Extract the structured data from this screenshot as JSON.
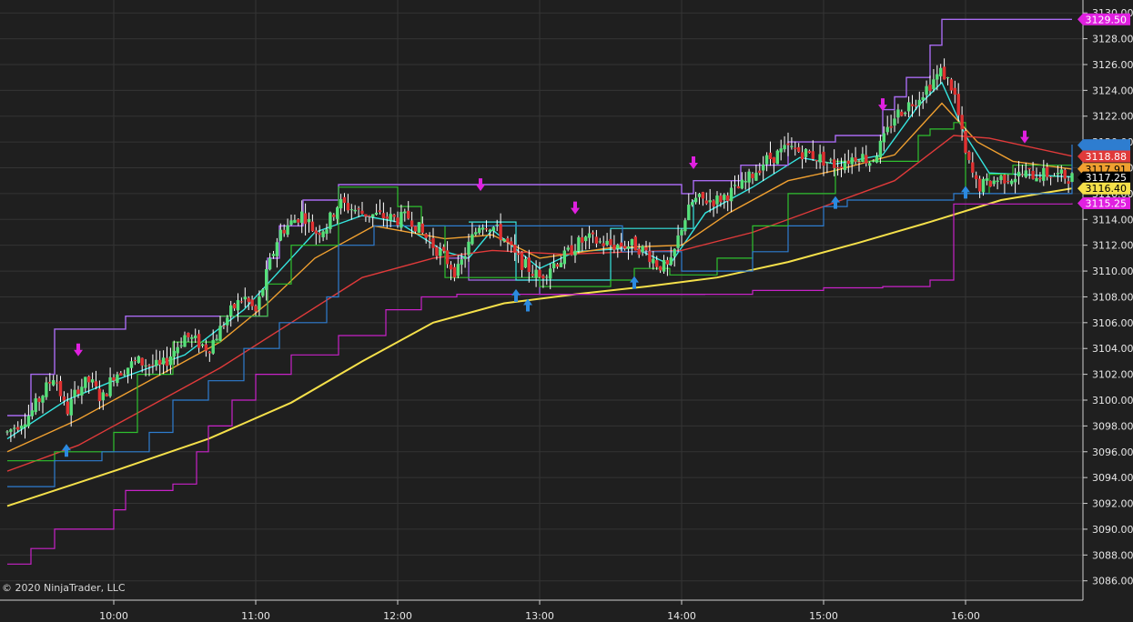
{
  "copyright": "© 2020 NinjaTrader, LLC",
  "colors": {
    "background": "#1f1f1f",
    "grid": "#343434",
    "axis": "#cfcfcf",
    "up_candle": "#56e07a",
    "down_candle": "#e03131",
    "wick": "#ffffff",
    "ema_fast": "#35e6e0",
    "ema_mid": "#f0a030",
    "ema_slow": "#e03a3a",
    "sma_long": "#f5e04a",
    "donchian_fast_high": "#a86af0",
    "donchian_fast_low": "#a86af0",
    "donchian_mid": "#2fc02f",
    "donchian_slow": "#2e7dd0",
    "donchian_slowest": "#c822c8",
    "arrow_up": "#2b8ae0",
    "arrow_down": "#e020e0"
  },
  "chart_data": {
    "type": "candlestick",
    "xlabel": "",
    "ylabel": "",
    "x_range": [
      "09:15",
      "16:45"
    ],
    "ylim": [
      3084.5,
      3131.0
    ],
    "x_ticks": [
      "10:00",
      "11:00",
      "12:00",
      "13:00",
      "14:00",
      "15:00",
      "16:00"
    ],
    "y_ticks": [
      "3086.00",
      "3088.00",
      "3090.00",
      "3092.00",
      "3094.00",
      "3096.00",
      "3098.00",
      "3100.00",
      "3102.00",
      "3104.00",
      "3106.00",
      "3108.00",
      "3110.00",
      "3112.00",
      "3114.00",
      "3116.00",
      "3118.00",
      "3120.00",
      "3122.00",
      "3124.00",
      "3126.00",
      "3128.00",
      "3130.00"
    ],
    "grid": true,
    "price_labels": [
      {
        "value": 3129.5,
        "text": "3129.50",
        "color": "#e020e0",
        "text_color": "#ffffff"
      },
      {
        "value": 3119.75,
        "text": "",
        "color": "#2e7dd0",
        "text_color": "#ffffff"
      },
      {
        "value": 3118.88,
        "text": "3118.88",
        "color": "#e03a3a",
        "text_color": "#ffffff"
      },
      {
        "value": 3117.91,
        "text": "3117.91",
        "color": "#f0a030",
        "text_color": "#000000"
      },
      {
        "value": 3117.25,
        "text": "3117.25",
        "color": "#000000",
        "text_color": "#ffffff"
      },
      {
        "value": 3116.4,
        "text": "3116.40",
        "color": "#f5e04a",
        "text_color": "#000000"
      },
      {
        "value": 3115.25,
        "text": "3115.25",
        "color": "#e020e0",
        "text_color": "#ffffff"
      }
    ],
    "price_path": [
      [
        "09:15",
        3097.5
      ],
      [
        "09:25",
        3099.0
      ],
      [
        "09:35",
        3102.0
      ],
      [
        "09:40",
        3099.0
      ],
      [
        "09:45",
        3101.0
      ],
      [
        "09:50",
        3101.5
      ],
      [
        "09:55",
        3100.0
      ],
      [
        "10:00",
        3102.0
      ],
      [
        "10:10",
        3103.0
      ],
      [
        "10:20",
        3102.5
      ],
      [
        "10:30",
        3105.0
      ],
      [
        "10:40",
        3104.0
      ],
      [
        "10:50",
        3107.0
      ],
      [
        "10:55",
        3108.0
      ],
      [
        "11:00",
        3106.8
      ],
      [
        "11:05",
        3110.0
      ],
      [
        "11:10",
        3113.0
      ],
      [
        "11:20",
        3114.5
      ],
      [
        "11:25",
        3113.0
      ],
      [
        "11:30",
        3113.5
      ],
      [
        "11:35",
        3115.3
      ],
      [
        "11:45",
        3114.5
      ],
      [
        "12:00",
        3114.0
      ],
      [
        "12:05",
        3114.2
      ],
      [
        "12:10",
        3113.0
      ],
      [
        "12:20",
        3111.0
      ],
      [
        "12:25",
        3109.8
      ],
      [
        "12:30",
        3112.0
      ],
      [
        "12:35",
        3113.8
      ],
      [
        "12:40",
        3113.5
      ],
      [
        "12:45",
        3112.5
      ],
      [
        "12:50",
        3111.0
      ],
      [
        "13:00",
        3109.5
      ],
      [
        "13:05",
        3110.5
      ],
      [
        "13:10",
        3111.0
      ],
      [
        "13:15",
        3112.0
      ],
      [
        "13:20",
        3112.5
      ],
      [
        "13:30",
        3112.0
      ],
      [
        "13:40",
        3112.0
      ],
      [
        "13:45",
        3111.5
      ],
      [
        "13:50",
        3110.5
      ],
      [
        "13:55",
        3110.2
      ],
      [
        "14:00",
        3113.5
      ],
      [
        "14:05",
        3115.5
      ],
      [
        "14:15",
        3115.5
      ],
      [
        "14:25",
        3116.5
      ],
      [
        "14:35",
        3118.5
      ],
      [
        "14:45",
        3119.5
      ],
      [
        "14:55",
        3119.0
      ],
      [
        "15:05",
        3118.2
      ],
      [
        "15:15",
        3119.0
      ],
      [
        "15:20",
        3118.5
      ],
      [
        "15:25",
        3120.0
      ],
      [
        "15:30",
        3122.0
      ],
      [
        "15:40",
        3123.5
      ],
      [
        "15:45",
        3124.5
      ],
      [
        "15:50",
        3125.5
      ],
      [
        "15:55",
        3124.0
      ],
      [
        "16:00",
        3119.0
      ],
      [
        "16:05",
        3116.5
      ],
      [
        "16:15",
        3117.2
      ],
      [
        "16:25",
        3117.5
      ],
      [
        "16:35",
        3117.5
      ],
      [
        "16:45",
        3117.25
      ]
    ],
    "series": [
      {
        "name": "",
        "color": "#35e6e0",
        "width": 1.4,
        "step": false,
        "points": [
          [
            "09:15",
            3097.0
          ],
          [
            "09:40",
            3100.0
          ],
          [
            "10:00",
            3101.5
          ],
          [
            "10:30",
            3103.5
          ],
          [
            "10:55",
            3107.0
          ],
          [
            "11:05",
            3109.0
          ],
          [
            "11:25",
            3113.0
          ],
          [
            "11:45",
            3114.3
          ],
          [
            "12:00",
            3113.8
          ],
          [
            "12:20",
            3111.5
          ],
          [
            "12:30",
            3111.0
          ],
          [
            "12:40",
            3113.2
          ],
          [
            "13:00",
            3110.2
          ],
          [
            "13:15",
            3111.5
          ],
          [
            "13:40",
            3111.8
          ],
          [
            "13:55",
            3110.5
          ],
          [
            "14:10",
            3114.5
          ],
          [
            "14:30",
            3116.5
          ],
          [
            "14:50",
            3118.8
          ],
          [
            "15:05",
            3118.3
          ],
          [
            "15:25",
            3119.0
          ],
          [
            "15:40",
            3122.8
          ],
          [
            "15:50",
            3124.6
          ],
          [
            "16:00",
            3120.5
          ],
          [
            "16:10",
            3117.6
          ],
          [
            "16:45",
            3117.3
          ]
        ]
      },
      {
        "name": "",
        "color": "#f0a030",
        "width": 1.4,
        "step": false,
        "points": [
          [
            "09:15",
            3096.0
          ],
          [
            "09:45",
            3098.5
          ],
          [
            "10:15",
            3101.5
          ],
          [
            "10:45",
            3104.5
          ],
          [
            "11:05",
            3107.5
          ],
          [
            "11:25",
            3111.0
          ],
          [
            "11:50",
            3113.5
          ],
          [
            "12:20",
            3112.5
          ],
          [
            "12:40",
            3112.8
          ],
          [
            "13:00",
            3111.0
          ],
          [
            "13:30",
            3111.8
          ],
          [
            "14:00",
            3112.0
          ],
          [
            "14:20",
            3114.5
          ],
          [
            "14:45",
            3117.0
          ],
          [
            "15:05",
            3117.8
          ],
          [
            "15:30",
            3119.0
          ],
          [
            "15:50",
            3123.0
          ],
          [
            "16:05",
            3120.0
          ],
          [
            "16:20",
            3118.5
          ],
          [
            "16:45",
            3117.9
          ]
        ]
      },
      {
        "name": "",
        "color": "#e03a3a",
        "width": 1.4,
        "step": false,
        "points": [
          [
            "09:15",
            3094.5
          ],
          [
            "09:45",
            3096.5
          ],
          [
            "10:15",
            3099.5
          ],
          [
            "10:45",
            3102.5
          ],
          [
            "11:15",
            3106.0
          ],
          [
            "11:45",
            3109.5
          ],
          [
            "12:15",
            3111.0
          ],
          [
            "12:40",
            3111.6
          ],
          [
            "13:10",
            3111.3
          ],
          [
            "13:40",
            3111.5
          ],
          [
            "14:00",
            3111.6
          ],
          [
            "14:30",
            3113.0
          ],
          [
            "15:00",
            3115.0
          ],
          [
            "15:30",
            3117.0
          ],
          [
            "15:55",
            3120.5
          ],
          [
            "16:10",
            3120.3
          ],
          [
            "16:45",
            3118.9
          ]
        ]
      },
      {
        "name": "",
        "color": "#f5e04a",
        "width": 2,
        "step": false,
        "points": [
          [
            "09:15",
            3091.8
          ],
          [
            "10:00",
            3094.5
          ],
          [
            "10:40",
            3097.0
          ],
          [
            "11:15",
            3099.8
          ],
          [
            "11:45",
            3103.0
          ],
          [
            "12:15",
            3106.0
          ],
          [
            "12:45",
            3107.5
          ],
          [
            "13:15",
            3108.2
          ],
          [
            "13:45",
            3108.8
          ],
          [
            "14:15",
            3109.5
          ],
          [
            "14:45",
            3110.7
          ],
          [
            "15:15",
            3112.2
          ],
          [
            "15:45",
            3113.8
          ],
          [
            "16:15",
            3115.5
          ],
          [
            "16:45",
            3116.4
          ]
        ]
      },
      {
        "name": "",
        "color": "#a86af0",
        "width": 1.4,
        "step": true,
        "points": [
          [
            "09:15",
            3098.8
          ],
          [
            "09:25",
            3102.0
          ],
          [
            "09:35",
            3105.5
          ],
          [
            "10:05",
            3106.5
          ],
          [
            "10:35",
            3106.5
          ],
          [
            "11:05",
            3111.0
          ],
          [
            "11:10",
            3113.5
          ],
          [
            "11:20",
            3115.5
          ],
          [
            "11:35",
            3116.7
          ],
          [
            "13:45",
            3116.7
          ],
          [
            "14:00",
            3116.0
          ],
          [
            "14:05",
            3117.0
          ],
          [
            "14:25",
            3118.2
          ],
          [
            "14:45",
            3120.0
          ],
          [
            "15:05",
            3120.5
          ],
          [
            "15:25",
            3122.5
          ],
          [
            "15:30",
            3123.5
          ],
          [
            "15:35",
            3125.0
          ],
          [
            "15:45",
            3127.5
          ],
          [
            "15:50",
            3129.5
          ],
          [
            "16:45",
            3129.5
          ]
        ]
      },
      {
        "name": "",
        "color": "#a86af0",
        "width": 1.2,
        "step": true,
        "points": [
          [
            "12:20",
            3111.0
          ],
          [
            "12:30",
            3109.3
          ],
          [
            "12:50",
            3109.3
          ],
          [
            "13:00",
            3108.2
          ],
          [
            "14:10",
            3108.2
          ]
        ]
      },
      {
        "name": "",
        "color": "#35e6e0",
        "width": 1.2,
        "step": true,
        "points": [
          [
            "12:30",
            3113.8
          ],
          [
            "12:50",
            3109.3
          ],
          [
            "13:20",
            3109.3
          ],
          [
            "13:30",
            3113.3
          ],
          [
            "14:00",
            3113.3
          ],
          [
            "14:05",
            3115.5
          ]
        ]
      },
      {
        "name": "",
        "color": "#2fc02f",
        "width": 1.2,
        "step": true,
        "points": [
          [
            "09:15",
            3095.3
          ],
          [
            "09:35",
            3096.0
          ],
          [
            "10:00",
            3097.5
          ],
          [
            "10:10",
            3102.0
          ],
          [
            "10:25",
            3104.5
          ],
          [
            "10:45",
            3106.5
          ],
          [
            "11:05",
            3109.0
          ],
          [
            "11:15",
            3112.0
          ],
          [
            "11:35",
            3116.5
          ],
          [
            "12:00",
            3115.0
          ],
          [
            "12:10",
            3113.5
          ],
          [
            "12:20",
            3109.5
          ],
          [
            "12:45",
            3109.5
          ],
          [
            "13:00",
            3108.8
          ],
          [
            "13:30",
            3109.3
          ],
          [
            "13:40",
            3110.2
          ],
          [
            "13:55",
            3109.7
          ],
          [
            "14:15",
            3111.0
          ],
          [
            "14:30",
            3113.5
          ],
          [
            "14:45",
            3116.0
          ],
          [
            "15:05",
            3118.5
          ],
          [
            "15:35",
            3118.5
          ],
          [
            "15:40",
            3120.5
          ],
          [
            "15:45",
            3121.0
          ],
          [
            "15:55",
            3121.5
          ],
          [
            "16:00",
            3116.0
          ],
          [
            "16:10",
            3117.5
          ],
          [
            "16:20",
            3118.2
          ],
          [
            "16:45",
            3118.2
          ]
        ]
      },
      {
        "name": "",
        "color": "#2e7dd0",
        "width": 1.2,
        "step": true,
        "points": [
          [
            "09:15",
            3093.3
          ],
          [
            "09:35",
            3095.3
          ],
          [
            "09:55",
            3096.0
          ],
          [
            "10:15",
            3097.5
          ],
          [
            "10:25",
            3100.0
          ],
          [
            "10:40",
            3101.5
          ],
          [
            "10:55",
            3104.0
          ],
          [
            "11:10",
            3106.0
          ],
          [
            "11:30",
            3108.0
          ],
          [
            "11:35",
            3112.0
          ],
          [
            "11:50",
            3113.5
          ],
          [
            "12:55",
            3113.5
          ],
          [
            "13:10",
            3113.5
          ],
          [
            "13:35",
            3111.5
          ],
          [
            "14:00",
            3110.0
          ],
          [
            "14:15",
            3110.0
          ],
          [
            "14:30",
            3111.5
          ],
          [
            "14:45",
            3113.5
          ],
          [
            "15:00",
            3115.0
          ],
          [
            "15:10",
            3115.5
          ],
          [
            "15:55",
            3116.0
          ],
          [
            "16:05",
            3116.0
          ],
          [
            "16:30",
            3116.0
          ],
          [
            "16:45",
            3119.8
          ]
        ]
      },
      {
        "name": "",
        "color": "#c822c8",
        "width": 1.2,
        "step": true,
        "points": [
          [
            "09:15",
            3087.3
          ],
          [
            "09:25",
            3088.5
          ],
          [
            "09:35",
            3090.0
          ],
          [
            "10:00",
            3091.5
          ],
          [
            "10:05",
            3093.0
          ],
          [
            "10:25",
            3093.5
          ],
          [
            "10:35",
            3096.0
          ],
          [
            "10:40",
            3098.0
          ],
          [
            "10:50",
            3100.0
          ],
          [
            "11:00",
            3102.0
          ],
          [
            "11:15",
            3103.5
          ],
          [
            "11:35",
            3105.0
          ],
          [
            "11:55",
            3107.0
          ],
          [
            "12:10",
            3108.0
          ],
          [
            "12:25",
            3108.2
          ],
          [
            "14:00",
            3108.2
          ],
          [
            "14:30",
            3108.5
          ],
          [
            "15:00",
            3108.7
          ],
          [
            "15:25",
            3108.8
          ],
          [
            "15:45",
            3109.3
          ],
          [
            "15:55",
            3115.2
          ],
          [
            "16:45",
            3115.25
          ]
        ]
      }
    ],
    "arrows_up": [
      "09:40",
      "12:50",
      "12:55",
      "13:40",
      "15:05",
      "16:00"
    ],
    "arrows_down": [
      "09:45",
      "12:35",
      "13:15",
      "14:05",
      "15:25",
      "16:25"
    ]
  }
}
